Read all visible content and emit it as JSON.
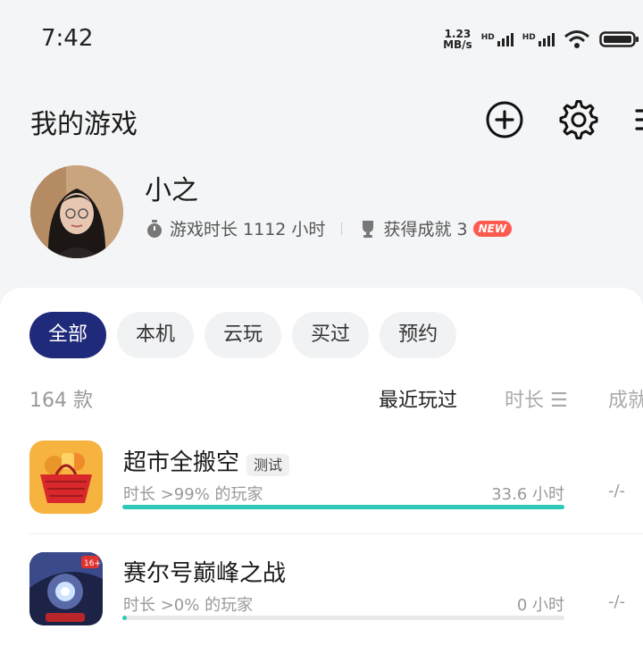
{
  "status_bar": {
    "time": "7:42",
    "net_speed_value": "1.23",
    "net_speed_unit": "MB/s",
    "hd1": "HD",
    "hd2": "HD",
    "battery": "9"
  },
  "header": {
    "title": "我的游戏",
    "icons": [
      "add-icon",
      "gear-icon",
      "menu-icon"
    ]
  },
  "profile": {
    "name": "小之",
    "playtime_label": "游戏时长 1112 小时",
    "achievements_label": "获得成就 3",
    "new_badge": "NEW"
  },
  "filters": {
    "active": "全部",
    "tabs": [
      "全部",
      "本机",
      "云玩",
      "买过",
      "预约"
    ]
  },
  "list": {
    "count": "164 款",
    "sort_recent": "最近玩过",
    "sort_duration": "时长 ☰",
    "sort_achievement": "成就"
  },
  "games": [
    {
      "name": "超市全搬空",
      "tag": "测试",
      "subtitle": "时长 >99% 的玩家",
      "hours": "33.6 小时",
      "achievement": "-/-",
      "progress": 1.0
    },
    {
      "name": "赛尔号巅峰之战",
      "tag": "",
      "subtitle": "时长 >0% 的玩家",
      "hours": "0 小时",
      "achievement": "-/-",
      "progress": 0.01
    }
  ],
  "colors": {
    "accent": "#1f2a7a",
    "progress": "#2ec9b8",
    "new_badge": "#ff5a4e"
  }
}
